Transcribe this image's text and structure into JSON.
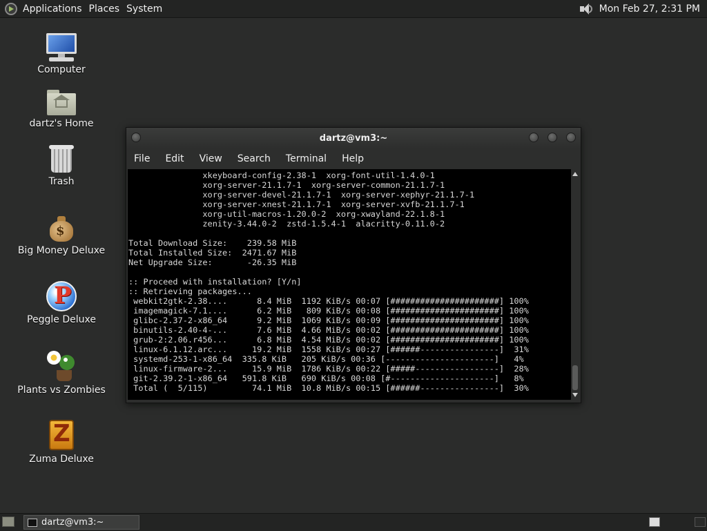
{
  "top_panel": {
    "menus": [
      "Applications",
      "Places",
      "System"
    ],
    "clock": "Mon Feb 27,  2:31 PM"
  },
  "desktop_icons": [
    {
      "label": "Computer"
    },
    {
      "label": "dartz's Home"
    },
    {
      "label": "Trash"
    },
    {
      "label": "Big Money Deluxe"
    },
    {
      "label": "Peggle Deluxe"
    },
    {
      "label": "Plants vs Zombies"
    },
    {
      "label": "Zuma Deluxe"
    }
  ],
  "terminal": {
    "title": "dartz@vm3:~",
    "menu": [
      "File",
      "Edit",
      "View",
      "Search",
      "Terminal",
      "Help"
    ],
    "lines": [
      "               xkeyboard-config-2.38-1  xorg-font-util-1.4.0-1",
      "               xorg-server-21.1.7-1  xorg-server-common-21.1.7-1",
      "               xorg-server-devel-21.1.7-1  xorg-server-xephyr-21.1.7-1",
      "               xorg-server-xnest-21.1.7-1  xorg-server-xvfb-21.1.7-1",
      "               xorg-util-macros-1.20.0-2  xorg-xwayland-22.1.8-1",
      "               zenity-3.44.0-2  zstd-1.5.4-1  alacritty-0.11.0-2",
      "",
      "Total Download Size:    239.58 MiB",
      "Total Installed Size:  2471.67 MiB",
      "Net Upgrade Size:       -26.35 MiB",
      "",
      ":: Proceed with installation? [Y/n]",
      ":: Retrieving packages...",
      " webkit2gtk-2.38....      8.4 MiB  1192 KiB/s 00:07 [######################] 100%",
      " imagemagick-7.1....      6.2 MiB   809 KiB/s 00:08 [######################] 100%",
      " glibc-2.37-2-x86_64      9.2 MiB  1069 KiB/s 00:09 [######################] 100%",
      " binutils-2.40-4-...      7.6 MiB  4.66 MiB/s 00:02 [######################] 100%",
      " grub-2:2.06.r456...      6.8 MiB  4.54 MiB/s 00:02 [######################] 100%",
      " linux-6.1.12.arc...     19.2 MiB  1558 KiB/s 00:27 [######----------------]  31%",
      " systemd-253-1-x86_64  335.8 KiB   205 KiB/s 00:36 [----------------------]   4%",
      " linux-firmware-2...     15.9 MiB  1786 KiB/s 00:22 [#####-----------------]  28%",
      " git-2.39.2-1-x86_64   591.8 KiB   690 KiB/s 00:08 [#---------------------]   8%",
      " Total (  5/115)         74.1 MiB  10.8 MiB/s 00:15 [######----------------]  30%"
    ]
  },
  "bottom_panel": {
    "task_label": "dartz@vm3:~"
  }
}
